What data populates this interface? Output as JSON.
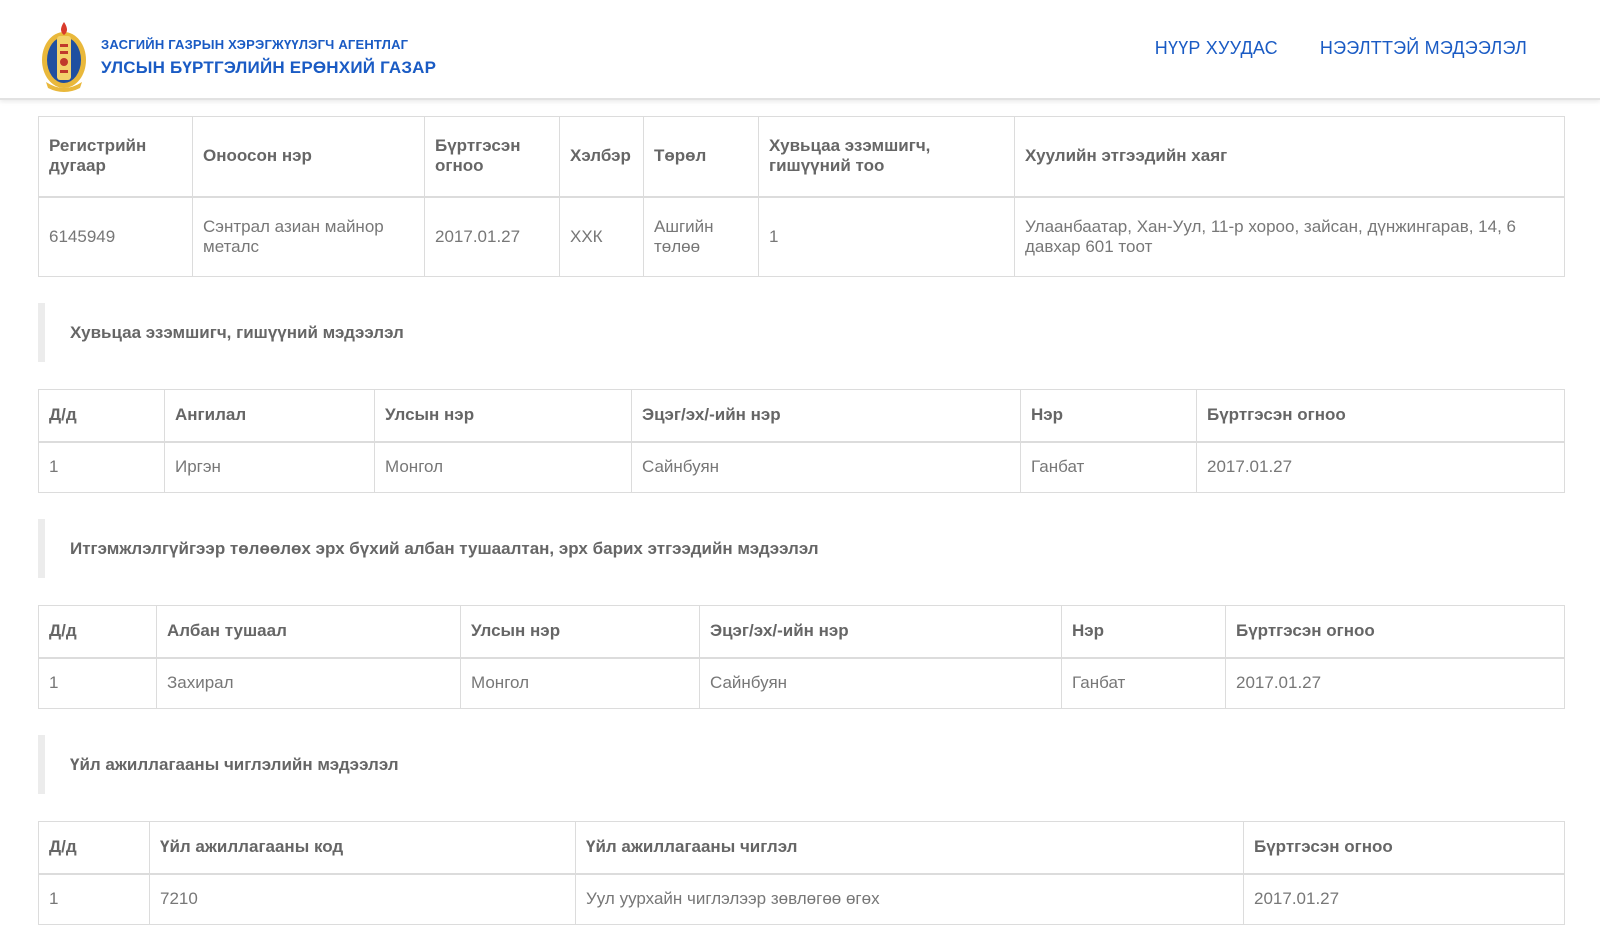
{
  "header": {
    "agency_line1": "ЗАСГИЙН ГАЗРЫН ХЭРЭГЖҮҮЛЭГЧ АГЕНТЛАГ",
    "agency_line2": "УЛСЫН БҮРТГЭЛИЙН ЕРӨНХИЙ ГАЗАР",
    "nav": [
      "НҮҮР ХУУДАС",
      "НЭЭЛТТЭЙ МЭДЭЭЛЭЛ"
    ],
    "colors": {
      "brand": "#1a5bc4"
    }
  },
  "company": {
    "headers": [
      "Регистрийн дугаар",
      "Оноосон нэр",
      "Бүртгэсэн огноо",
      "Хэлбэр",
      "Төрөл",
      "Хувьцаа эзэмшигч, гишүүний тоо",
      "Хуулийн этгээдийн хаяг"
    ],
    "row": [
      "6145949",
      "Сэнтрал азиан майнор металс",
      "2017.01.27",
      "ХХК",
      "Ашгийн төлөө",
      "1",
      "Улаанбаатар, Хан-Уул, 11-р хороо, зайсан, дүнжингарав, 14, 6 давхар 601 тоот"
    ]
  },
  "shareholders": {
    "title": "Хувьцаа эзэмшигч, гишүүний мэдээлэл",
    "headers": [
      "Д/д",
      "Ангилал",
      "Улсын нэр",
      "Эцэг/эх/-ийн нэр",
      "Нэр",
      "Бүртгэсэн огноо"
    ],
    "rows": [
      [
        "1",
        "Иргэн",
        "Монгол",
        "Сайнбуян",
        "Ганбат",
        "2017.01.27"
      ]
    ]
  },
  "officials": {
    "title": "Итгэмжлэлгүйгээр төлөөлөх эрх бүхий албан тушаалтан, эрх барих этгээдийн мэдээлэл",
    "headers": [
      "Д/д",
      "Албан тушаал",
      "Улсын нэр",
      "Эцэг/эх/-ийн нэр",
      "Нэр",
      "Бүртгэсэн огноо"
    ],
    "rows": [
      [
        "1",
        "Захирал",
        "Монгол",
        "Сайнбуян",
        "Ганбат",
        "2017.01.27"
      ]
    ]
  },
  "activities": {
    "title": "Үйл ажиллагааны чиглэлийн мэдээлэл",
    "headers": [
      "Д/д",
      "Үйл ажиллагааны код",
      "Үйл ажиллагааны чиглэл",
      "Бүртгэсэн огноо"
    ],
    "rows": [
      [
        "1",
        "7210",
        "Уул уурхайн чиглэлээр зөвлөгөө өгөх",
        "2017.01.27"
      ]
    ]
  }
}
